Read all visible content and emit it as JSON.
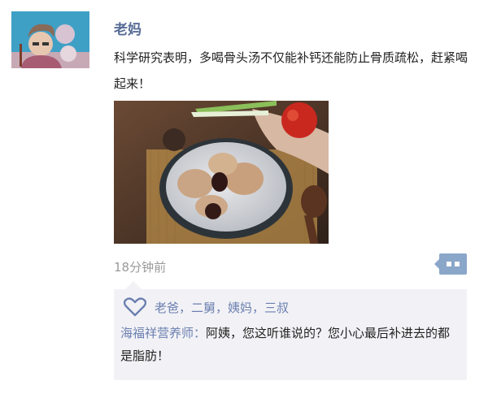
{
  "post": {
    "author": "老妈",
    "text": "科学研究表明，多喝骨头汤不仅能补钙还能防止骨质疏松，赶紧喝起来！",
    "time": "18分钟前"
  },
  "likes": {
    "names": "老爸，二舅，姨妈，三叔"
  },
  "comment": {
    "author": "海福祥营养师：",
    "text": "阿姨，您这听谁说的？您小心最后补进去的都是脂肪！"
  },
  "colors": {
    "link": "#576b95",
    "comment_bg": "#f2f2f6",
    "more_button": "#8aa6c9"
  }
}
